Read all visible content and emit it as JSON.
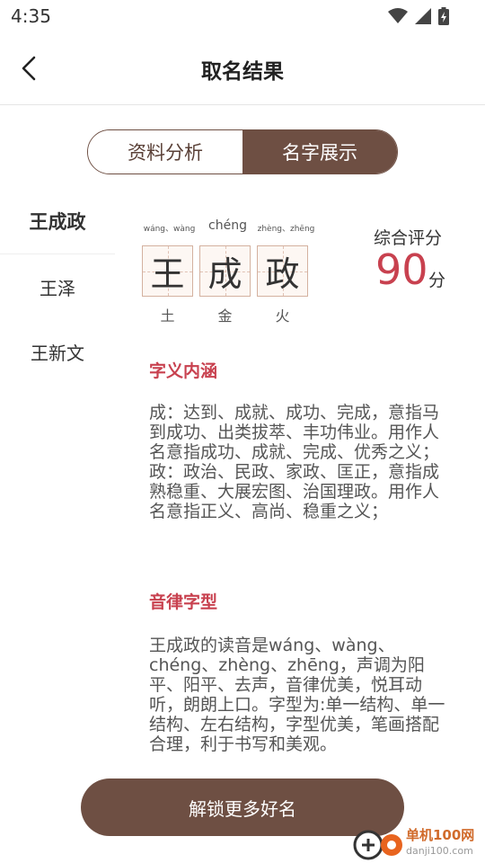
{
  "status": {
    "time": "4:35",
    "icons": [
      "wifi-icon",
      "signal-icon",
      "battery-charging-icon"
    ]
  },
  "header": {
    "title": "取名结果",
    "back_icon": "chevron-left-icon"
  },
  "tabs": [
    {
      "label": "资料分析",
      "active": false
    },
    {
      "label": "名字展示",
      "active": true
    }
  ],
  "names": [
    {
      "label": "王成政",
      "selected": true
    },
    {
      "label": "王泽",
      "selected": false
    },
    {
      "label": "王新文",
      "selected": false
    }
  ],
  "name_detail": {
    "chars": [
      {
        "char": "王",
        "pinyin": "wáng、wàng",
        "element": "土"
      },
      {
        "char": "成",
        "pinyin": "chéng",
        "element": "金"
      },
      {
        "char": "政",
        "pinyin": "zhèng、zhēng",
        "element": "火"
      }
    ],
    "score_label": "综合评分",
    "score": "90",
    "score_unit": "分"
  },
  "sections": [
    {
      "title": "字义内涵",
      "text": "成：达到、成就、成功、完成，意指马到成功、出类拔萃、丰功伟业。用作人名意指成功、成就、完成、优秀之义；政：政治、民政、家政、匡正，意指成熟稳重、大展宏图、治国理政。用作人名意指正义、高尚、稳重之义；"
    },
    {
      "title": "音律字型",
      "text": "王成政的读音是wáng、wàng、chéng、zhèng、zhēng，声调为阳平、阳平、去声，音律优美，悦耳动听，朗朗上口。字型为:单一结构、单一结构、左右结构，字型优美，笔画搭配合理，利于书写和美观。"
    }
  ],
  "unlock_button": "解锁更多好名",
  "watermark": {
    "line1": "单机100网",
    "line2": "danji100.com"
  },
  "colors": {
    "accent": "#6e4f43",
    "score_red": "#c8414f",
    "char_box_bg": "#fdf7f3"
  }
}
